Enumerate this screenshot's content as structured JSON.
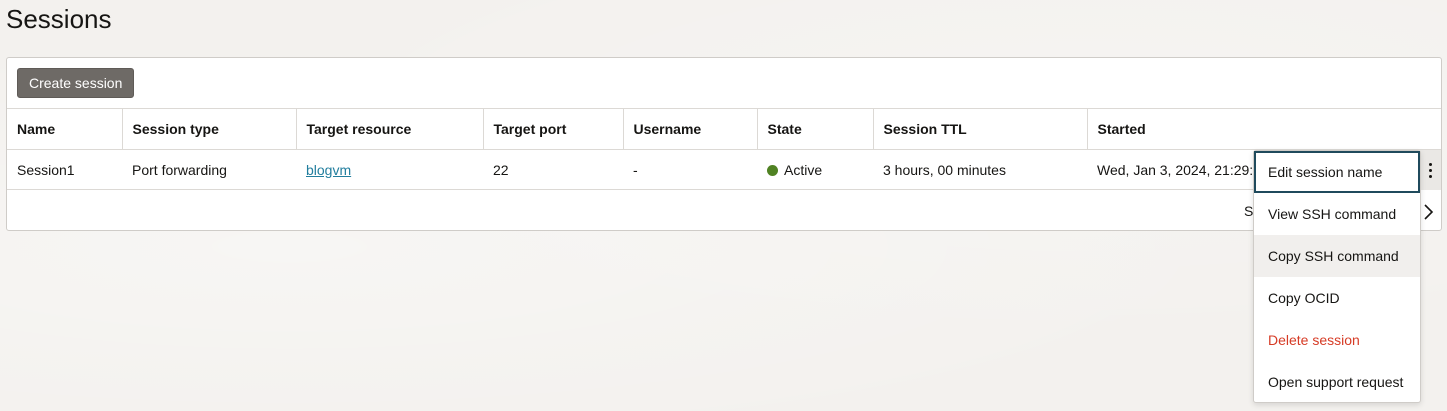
{
  "page": {
    "title": "Sessions"
  },
  "toolbar": {
    "create_label": "Create session"
  },
  "table": {
    "columns": [
      "Name",
      "Session type",
      "Target resource",
      "Target port",
      "Username",
      "State",
      "Session TTL",
      "Started"
    ],
    "rows": [
      {
        "name": "Session1",
        "session_type": "Port forwarding",
        "target_resource": "blogvm",
        "target_port": "22",
        "username": "-",
        "state": "Active",
        "session_ttl": "3 hours, 00 minutes",
        "started": "Wed, Jan 3, 2024, 21:29:"
      }
    ],
    "footer_text": "S"
  },
  "colors": {
    "state_active": "#508223",
    "link": "#227e9e",
    "danger": "#d63b25",
    "button": "#6e6a66"
  },
  "icons": {
    "row_actions": "kebab-menu-icon",
    "pager_next": "chevron-right-icon"
  },
  "actions_menu": {
    "items": [
      {
        "label": "Edit session name",
        "state": "focused"
      },
      {
        "label": "View SSH command",
        "state": ""
      },
      {
        "label": "Copy SSH command",
        "state": "hover"
      },
      {
        "label": "Copy OCID",
        "state": ""
      },
      {
        "label": "Delete session",
        "state": "danger"
      },
      {
        "label": "Open support request",
        "state": ""
      }
    ]
  }
}
